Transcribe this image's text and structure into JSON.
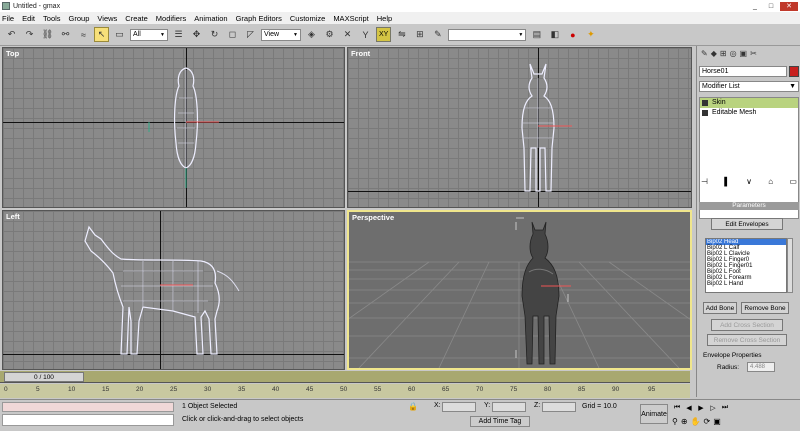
{
  "window": {
    "title": "Untitled - gmax",
    "min": "_",
    "max": "□",
    "close": "✕"
  },
  "menu": [
    "File",
    "Edit",
    "Tools",
    "Group",
    "Views",
    "Create",
    "Modifiers",
    "Animation",
    "Graph Editors",
    "Customize",
    "MAXScript",
    "Help"
  ],
  "toolbar": {
    "filter": "All",
    "refcoord": "View",
    "axis": "XY"
  },
  "viewports": {
    "top": {
      "label": "Top"
    },
    "front": {
      "label": "Front"
    },
    "left": {
      "label": "Left"
    },
    "perspective": {
      "label": "Perspective"
    }
  },
  "panel": {
    "object_name": "Horse01",
    "modifier_list": "Modifier List",
    "stack": [
      "Skin",
      "Editable Mesh"
    ],
    "parameters_header": "Parameters",
    "edit_envelopes": "Edit Envelopes",
    "bones": [
      "Bip02 Head",
      "Bip02 L Calf",
      "Bip02 L Clavicle",
      "Bip02 L Finger0",
      "Bip02 L Finger01",
      "Bip02 L Foot",
      "Bip02 L Forearm",
      "Bip02 L Hand"
    ],
    "add_bone": "Add Bone",
    "remove_bone": "Remove Bone",
    "add_cross_section": "Add Cross Section",
    "remove_cross_section": "Remove Cross Section",
    "envelope_properties": "Envelope Properties",
    "radius_label": "Radius:",
    "radius_value": "4.488"
  },
  "timeline": {
    "frame": "0 / 100",
    "ticks": [
      "0",
      "5",
      "10",
      "15",
      "20",
      "25",
      "30",
      "35",
      "40",
      "45",
      "50",
      "55",
      "60",
      "65",
      "70",
      "75",
      "80",
      "85",
      "90",
      "95"
    ]
  },
  "status": {
    "selection": "1 Object Selected",
    "prompt": "Click or click-and-drag to select objects",
    "x_label": "X:",
    "y_label": "Y:",
    "z_label": "Z:",
    "grid": "Grid = 10.0",
    "add_time_tag": "Add Time Tag",
    "animate": "Animate"
  }
}
